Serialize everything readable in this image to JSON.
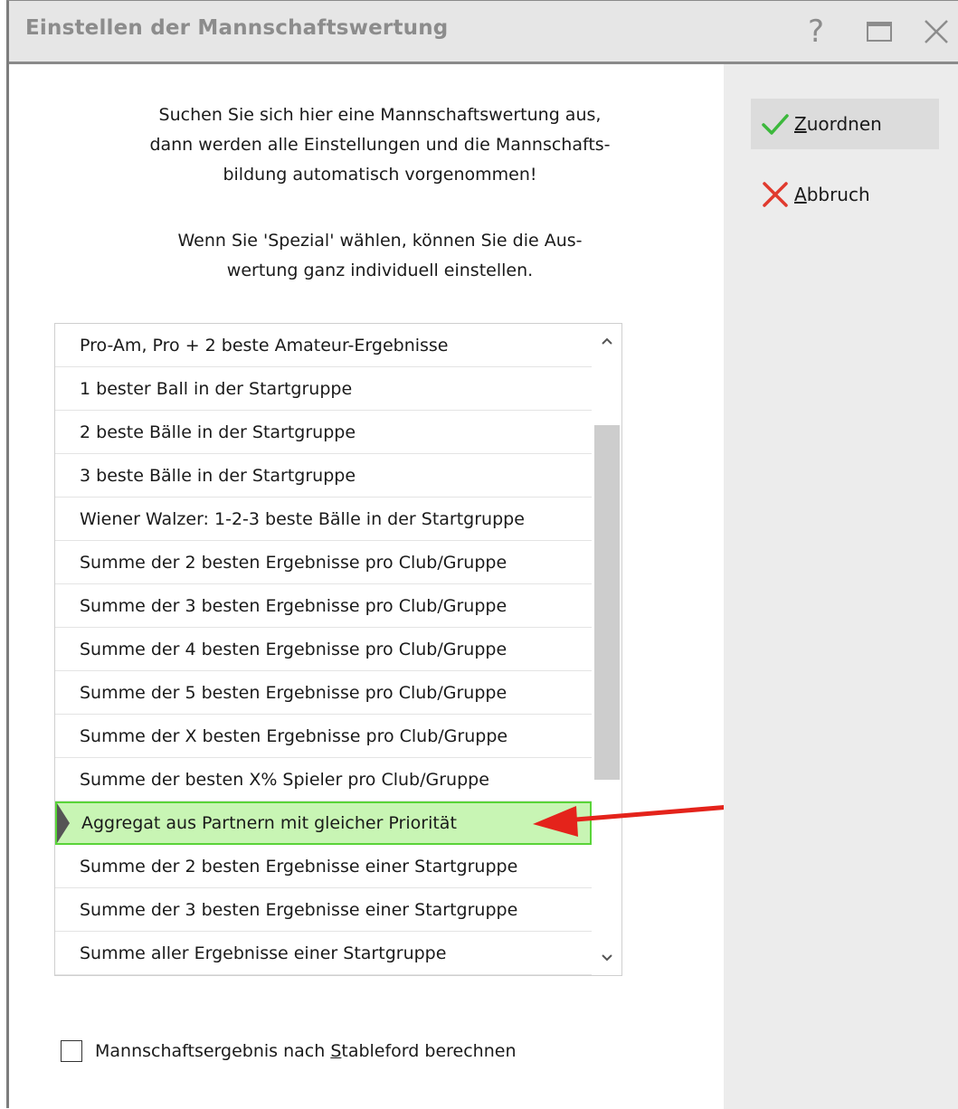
{
  "window": {
    "title": "Einstellen der Mannschaftswertung",
    "help_glyph": "?",
    "close_glyph": "✕"
  },
  "info": {
    "line1": "Suchen Sie sich hier eine Mannschaftswertung aus,",
    "line2": "dann werden alle Einstellungen und die Mannschafts-",
    "line3": "bildung automatisch vorgenommen!",
    "line4": "Wenn Sie 'Spezial' wählen, können Sie die Aus-",
    "line5": "wertung ganz individuell einstellen."
  },
  "actions": {
    "assign": {
      "mnemonic": "Z",
      "rest": "uordnen",
      "icon": "checkmark-icon",
      "color": "#3cb83c"
    },
    "cancel": {
      "mnemonic": "A",
      "rest": "bbruch",
      "icon": "close-x-icon",
      "color": "#e03a2e"
    }
  },
  "list": {
    "items": [
      "Pro-Am, Pro + 2 beste Amateur-Ergebnisse",
      "1 bester Ball in der Startgruppe",
      "2 beste Bälle in der Startgruppe",
      "3 beste Bälle in der Startgruppe",
      "Wiener Walzer: 1-2-3 beste Bälle in der Startgruppe",
      "Summe der 2 besten Ergebnisse pro Club/Gruppe",
      "Summe der 3 besten Ergebnisse pro Club/Gruppe",
      "Summe der 4 besten Ergebnisse pro Club/Gruppe",
      "Summe der 5 besten Ergebnisse pro Club/Gruppe",
      "Summe der X besten Ergebnisse pro Club/Gruppe",
      "Summe der besten X% Spieler pro Club/Gruppe",
      "Aggregat aus Partnern mit gleicher Priorität",
      "Summe der 2 besten Ergebnisse einer Startgruppe",
      "Summe der 3 besten Ergebnisse einer Startgruppe",
      "Summe aller Ergebnisse einer Startgruppe"
    ],
    "selected_index": 11,
    "selection_color": "#c8f5b4",
    "annotation_arrow_color": "#e4231b"
  },
  "checkbox": {
    "before": "Mannschaftsergebnis nach ",
    "mnemonic": "S",
    "after": "tableford berechnen",
    "checked": false
  }
}
